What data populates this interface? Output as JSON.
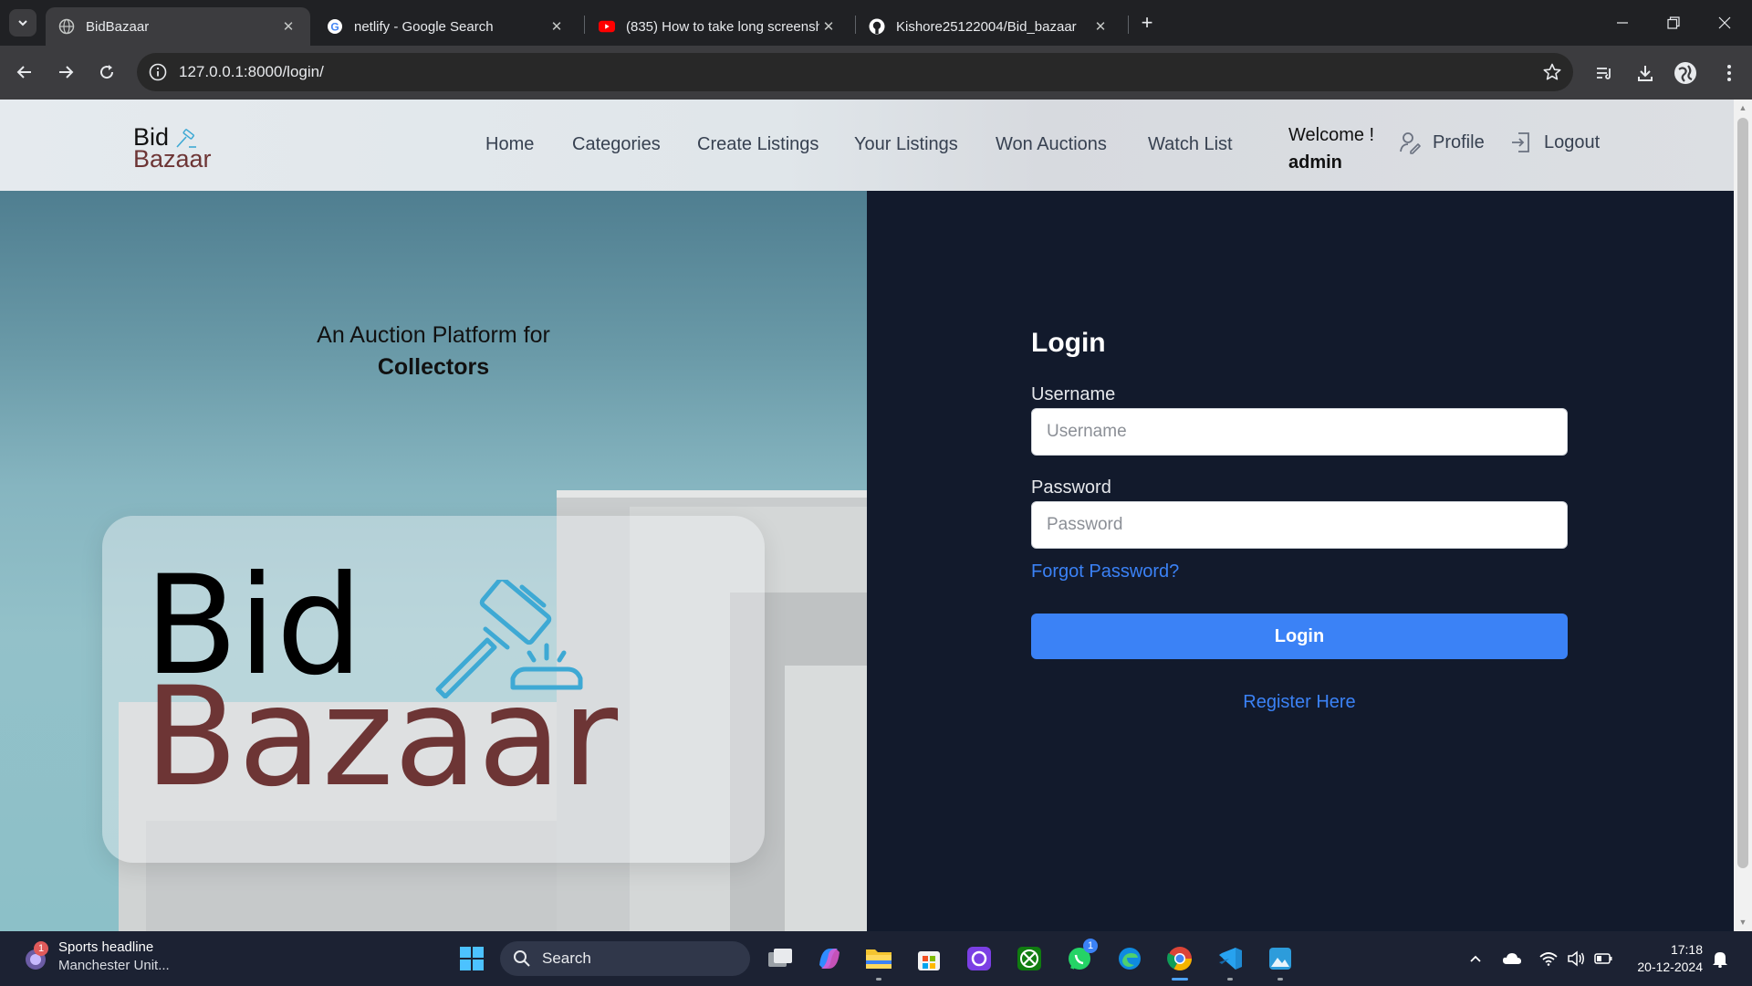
{
  "browser": {
    "tabs": [
      {
        "title": "BidBazaar",
        "active": true,
        "icon": "globe-icon"
      },
      {
        "title": "netlify - Google Search",
        "active": false,
        "icon": "google-icon"
      },
      {
        "title": "(835) How to take long screensh",
        "active": false,
        "icon": "youtube-icon"
      },
      {
        "title": "Kishore25122004/Bid_bazaar",
        "active": false,
        "icon": "github-icon"
      }
    ],
    "url": "127.0.0.1:8000/login/"
  },
  "site": {
    "logo": {
      "line1": "Bid",
      "line2": "Bazaar"
    },
    "nav": {
      "home": "Home",
      "categories": "Categories",
      "create_listings": "Create Listings",
      "your_listings": "Your Listings",
      "won_auctions": "Won Auctions",
      "watch_list": "Watch List",
      "welcome": "Welcome !",
      "username": "admin",
      "profile": "Profile",
      "logout": "Logout"
    },
    "hero": {
      "tagline_line1": "An Auction Platform for",
      "tagline_line2": "Collectors",
      "big_logo_line1": "Bid",
      "big_logo_line2": "Bazaar"
    },
    "login": {
      "title": "Login",
      "username_label": "Username",
      "username_placeholder": "Username",
      "username_value": "",
      "password_label": "Password",
      "password_placeholder": "Password",
      "password_value": "",
      "forgot": "Forgot Password?",
      "button": "Login",
      "register": "Register Here"
    },
    "colors": {
      "accent_blue": "#3b82f6",
      "panel_dark": "#121a2c",
      "brand_maroon": "#6d3535",
      "gavel_blue": "#3ea9d4"
    }
  },
  "taskbar": {
    "news_title": "Sports headline",
    "news_sub": "Manchester Unit...",
    "news_badge": "1",
    "search_label": "Search",
    "whatsapp_badge": "1",
    "time": "17:18",
    "date": "20-12-2024"
  }
}
